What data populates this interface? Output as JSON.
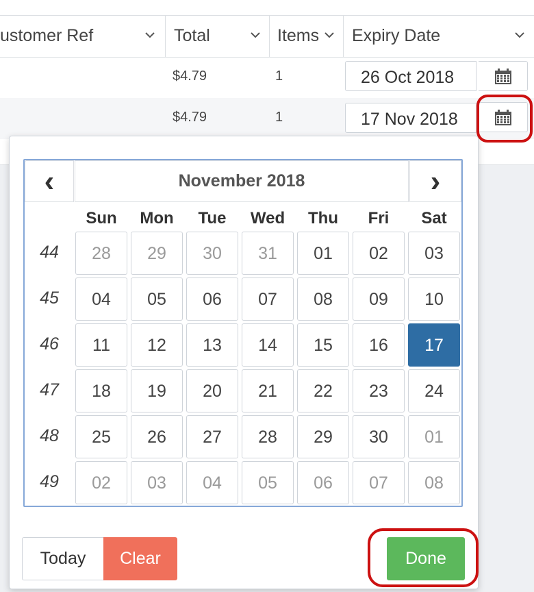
{
  "table": {
    "headers": [
      "ustomer Ref",
      "Total",
      "Items",
      "Expiry Date"
    ],
    "rows": [
      {
        "total": "$4.79",
        "items": "1",
        "expiry": "26 Oct 2018"
      },
      {
        "total": "$4.79",
        "items": "1",
        "expiry": "17 Nov 2018"
      }
    ]
  },
  "datepicker": {
    "month_title": "November 2018",
    "prev_glyph": "‹",
    "next_glyph": "›",
    "weekdays": [
      "Sun",
      "Mon",
      "Tue",
      "Wed",
      "Thu",
      "Fri",
      "Sat"
    ],
    "weeks": [
      {
        "week": "44",
        "days": [
          "28",
          "29",
          "30",
          "31",
          "01",
          "02",
          "03"
        ],
        "muted": [
          true,
          true,
          true,
          true,
          false,
          false,
          false
        ]
      },
      {
        "week": "45",
        "days": [
          "04",
          "05",
          "06",
          "07",
          "08",
          "09",
          "10"
        ],
        "muted": [
          false,
          false,
          false,
          false,
          false,
          false,
          false
        ]
      },
      {
        "week": "46",
        "days": [
          "11",
          "12",
          "13",
          "14",
          "15",
          "16",
          "17"
        ],
        "muted": [
          false,
          false,
          false,
          false,
          false,
          false,
          false
        ]
      },
      {
        "week": "47",
        "days": [
          "18",
          "19",
          "20",
          "21",
          "22",
          "23",
          "24"
        ],
        "muted": [
          false,
          false,
          false,
          false,
          false,
          false,
          false
        ]
      },
      {
        "week": "48",
        "days": [
          "25",
          "26",
          "27",
          "28",
          "29",
          "30",
          "01"
        ],
        "muted": [
          false,
          false,
          false,
          false,
          false,
          false,
          true
        ]
      },
      {
        "week": "49",
        "days": [
          "02",
          "03",
          "04",
          "05",
          "06",
          "07",
          "08"
        ],
        "muted": [
          true,
          true,
          true,
          true,
          true,
          true,
          true
        ]
      }
    ],
    "selected": {
      "week_index": 2,
      "day_index": 6
    },
    "buttons": {
      "today": "Today",
      "clear": "Clear",
      "done": "Done"
    }
  },
  "colors": {
    "selected_day": "#2e6da4",
    "clear_button": "#f0705b",
    "done_button": "#5cb85c",
    "highlight": "#cc1111"
  },
  "icons": {
    "calendar": "calendar-icon",
    "sort": "chevron-down-icon"
  }
}
